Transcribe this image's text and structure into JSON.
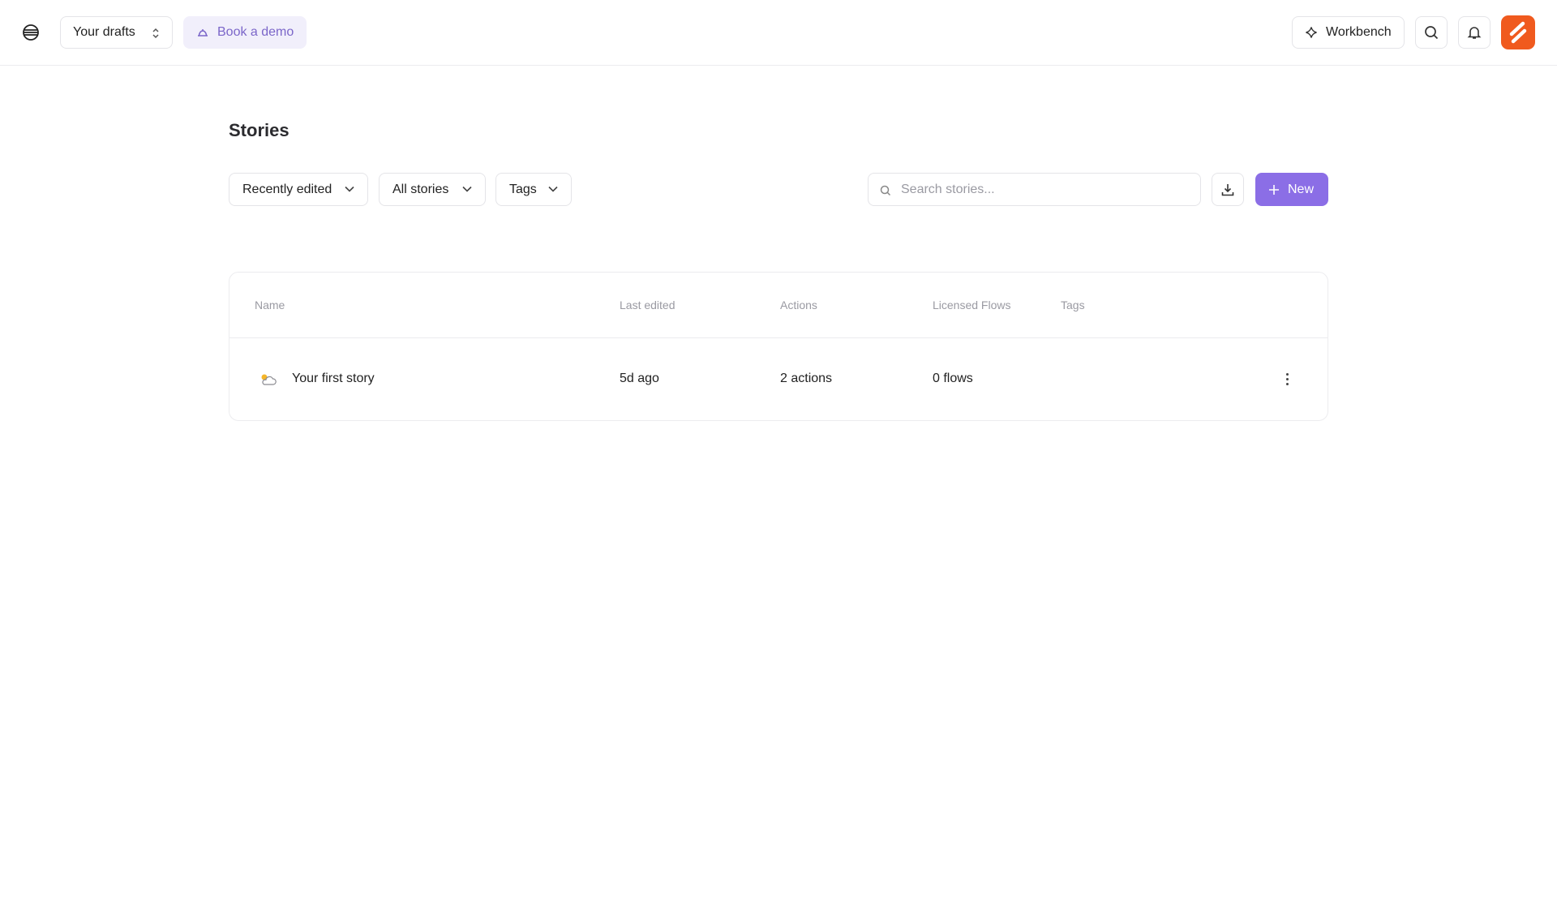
{
  "header": {
    "workspace_label": "Your drafts",
    "demo_label": "Book a demo",
    "workbench_label": "Workbench"
  },
  "page": {
    "title": "Stories"
  },
  "filters": {
    "sort_label": "Recently edited",
    "scope_label": "All stories",
    "tags_label": "Tags"
  },
  "search": {
    "placeholder": "Search stories..."
  },
  "actions": {
    "new_label": "New"
  },
  "table": {
    "columns": [
      "Name",
      "Last edited",
      "Actions",
      "Licensed Flows",
      "Tags"
    ],
    "rows": [
      {
        "name": "Your first story",
        "last_edited": "5d ago",
        "actions": "2 actions",
        "flows": "0 flows",
        "tags": ""
      }
    ]
  },
  "colors": {
    "accent": "#8b6ee6",
    "demo_text": "#7b66c9",
    "avatar_bg": "#f05a1e"
  }
}
